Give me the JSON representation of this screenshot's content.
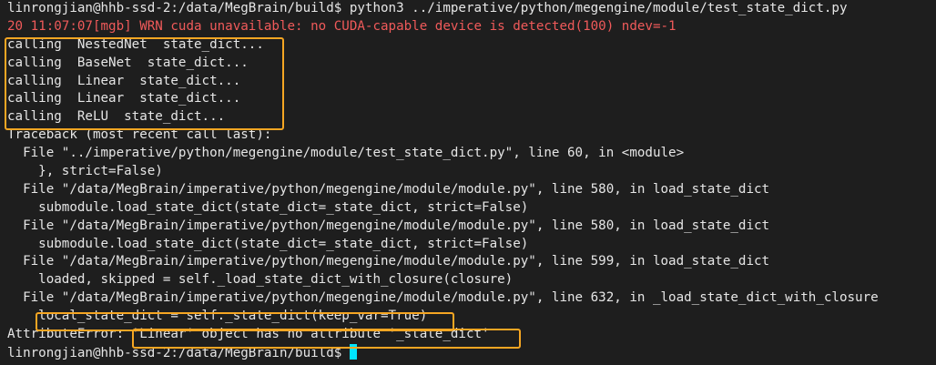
{
  "window": {
    "background": "#1e1e1e",
    "text_color": "#e6e6e6",
    "warn_color": "#f05a5a",
    "highlight_color": "#f5a623",
    "cursor_color": "#00e5ff"
  },
  "terminal": {
    "lines": [
      "linrongjian@hhb-ssd-2:/data/MegBrain/build$ python3 ../imperative/python/megengine/module/test_state_dict.py",
      "20 11:07:07[mgb] WRN cuda unavailable: no CUDA-capable device is detected(100) ndev=-1",
      "calling  NestedNet  state_dict...",
      "calling  BaseNet  state_dict...",
      "calling  Linear  state_dict...",
      "calling  Linear  state_dict...",
      "calling  ReLU  state_dict...",
      "Traceback (most recent call last):",
      "  File \"../imperative/python/megengine/module/test_state_dict.py\", line 60, in <module>",
      "    }, strict=False)",
      "  File \"/data/MegBrain/imperative/python/megengine/module/module.py\", line 580, in load_state_dict",
      "    submodule.load_state_dict(state_dict=_state_dict, strict=False)",
      "  File \"/data/MegBrain/imperative/python/megengine/module/module.py\", line 580, in load_state_dict",
      "    submodule.load_state_dict(state_dict=_state_dict, strict=False)",
      "  File \"/data/MegBrain/imperative/python/megengine/module/module.py\", line 599, in load_state_dict",
      "    loaded, skipped = self._load_state_dict_with_closure(closure)",
      "  File \"/data/MegBrain/imperative/python/megengine/module/module.py\", line 632, in _load_state_dict_with_closure",
      "    local_state_dict = self._state_dict(keep_var=True)",
      "AttributeError: 'Linear' object has no attribute '_state_dict'",
      "linrongjian@hhb-ssd-2:/data/MegBrain/build$"
    ]
  }
}
